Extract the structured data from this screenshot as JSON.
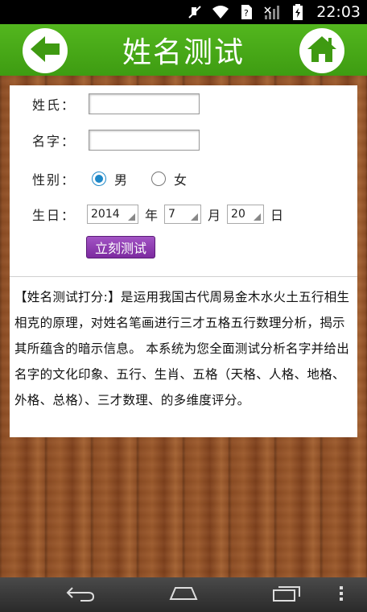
{
  "status_bar": {
    "time": "22:03",
    "icons": [
      "mute-icon",
      "wifi-icon",
      "sim-icon",
      "signal-icon",
      "battery-icon"
    ]
  },
  "header": {
    "title": "姓名测试",
    "back_icon": "arrow-left-icon",
    "home_icon": "home-icon"
  },
  "form": {
    "surname_label": "姓氏：",
    "surname_value": "",
    "given_label": "名字：",
    "given_value": "",
    "gender_label": "性别：",
    "gender_options": [
      {
        "label": "男",
        "checked": true
      },
      {
        "label": "女",
        "checked": false
      }
    ],
    "birthday_label": "生日：",
    "year_value": "2014",
    "year_unit": "年",
    "month_value": "7",
    "month_unit": "月",
    "day_value": "20",
    "day_unit": "日",
    "submit_label": "立刻测试"
  },
  "description": "【姓名测试打分:】是运用我国古代周易金木水火土五行相生相克的原理，对姓名笔画进行三才五格五行数理分析，揭示其所蕴含的暗示信息。 本系统为您全面测试分析名字并给出名字的文化印象、五行、生肖、五格（天格、人格、地格、外格、总格）、三才数理、的多维度评分。",
  "colors": {
    "header_green": "#4aab1a",
    "button_purple": "#8e3ab2",
    "radio_blue": "#1e88c8"
  },
  "nav_bar": {
    "icons": [
      "back-nav-icon",
      "home-nav-icon",
      "recents-icon",
      "menu-icon"
    ]
  }
}
